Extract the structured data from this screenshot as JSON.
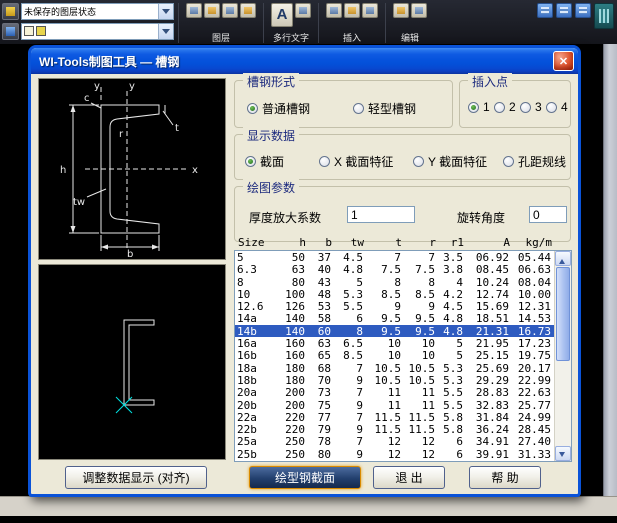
{
  "app_toolbar": {
    "layer_state_combo": "未保存的图层状态",
    "panel_layer": "图层",
    "mtext_icon_glyph": "A",
    "mtext_label": "多行文字",
    "panel_insert": "插入",
    "panel_edit": "编辑"
  },
  "diagram": {
    "axis_y_left": "y",
    "axis_y_right": "y",
    "axis_x": "x",
    "dim_h": "h",
    "dim_b": "b",
    "dim_tw": "tw",
    "dim_t": "t",
    "dim_c": "c",
    "dim_r": "r"
  },
  "dialog": {
    "title": "WI-Tools制图工具 — 槽钢",
    "close_glyph": "✕",
    "form_group": {
      "title": "槽钢形式",
      "options": [
        {
          "label": "普通槽钢",
          "selected": true
        },
        {
          "label": "轻型槽钢",
          "selected": false
        }
      ]
    },
    "insert_group": {
      "title": "插入点",
      "options": [
        {
          "label": "1",
          "selected": true
        },
        {
          "label": "2",
          "selected": false
        },
        {
          "label": "3",
          "selected": false
        },
        {
          "label": "4",
          "selected": false
        }
      ]
    },
    "display_group": {
      "title": "显示数据",
      "options": [
        {
          "label": "截面",
          "selected": true
        },
        {
          "label": "X 截面特征",
          "selected": false
        },
        {
          "label": "Y 截面特征",
          "selected": false
        },
        {
          "label": "孔距规线",
          "selected": false
        }
      ]
    },
    "params_group": {
      "title": "绘图参数",
      "thickness_label": "厚度放大系数",
      "thickness_value": "1",
      "rotation_label": "旋转角度",
      "rotation_value": "0"
    },
    "table": {
      "headers": [
        "Size",
        "h",
        "b",
        "tw",
        "t",
        "r",
        "r1",
        "A",
        "kg/m"
      ],
      "selected_row": "14b",
      "rows": [
        [
          "5",
          "50",
          "37",
          "4.5",
          "7",
          "7",
          "3.5",
          "06.92",
          "05.44"
        ],
        [
          "6.3",
          "63",
          "40",
          "4.8",
          "7.5",
          "7.5",
          "3.8",
          "08.45",
          "06.63"
        ],
        [
          "8",
          "80",
          "43",
          "5",
          "8",
          "8",
          "4",
          "10.24",
          "08.04"
        ],
        [
          "10",
          "100",
          "48",
          "5.3",
          "8.5",
          "8.5",
          "4.2",
          "12.74",
          "10.00"
        ],
        [
          "12.6",
          "126",
          "53",
          "5.5",
          "9",
          "9",
          "4.5",
          "15.69",
          "12.31"
        ],
        [
          "14a",
          "140",
          "58",
          "6",
          "9.5",
          "9.5",
          "4.8",
          "18.51",
          "14.53"
        ],
        [
          "14b",
          "140",
          "60",
          "8",
          "9.5",
          "9.5",
          "4.8",
          "21.31",
          "16.73"
        ],
        [
          "16a",
          "160",
          "63",
          "6.5",
          "10",
          "10",
          "5",
          "21.95",
          "17.23"
        ],
        [
          "16b",
          "160",
          "65",
          "8.5",
          "10",
          "10",
          "5",
          "25.15",
          "19.75"
        ],
        [
          "18a",
          "180",
          "68",
          "7",
          "10.5",
          "10.5",
          "5.3",
          "25.69",
          "20.17"
        ],
        [
          "18b",
          "180",
          "70",
          "9",
          "10.5",
          "10.5",
          "5.3",
          "29.29",
          "22.99"
        ],
        [
          "20a",
          "200",
          "73",
          "7",
          "11",
          "11",
          "5.5",
          "28.83",
          "22.63"
        ],
        [
          "20b",
          "200",
          "75",
          "9",
          "11",
          "11",
          "5.5",
          "32.83",
          "25.77"
        ],
        [
          "22a",
          "220",
          "77",
          "7",
          "11.5",
          "11.5",
          "5.8",
          "31.84",
          "24.99"
        ],
        [
          "22b",
          "220",
          "79",
          "9",
          "11.5",
          "11.5",
          "5.8",
          "36.24",
          "28.45"
        ],
        [
          "25a",
          "250",
          "78",
          "7",
          "12",
          "12",
          "6",
          "34.91",
          "27.40"
        ],
        [
          "25b",
          "250",
          "80",
          "9",
          "12",
          "12",
          "6",
          "39.91",
          "31.33"
        ]
      ]
    },
    "buttons": {
      "adjust": "调整数据显示 (对齐)",
      "draw": "绘型钢截面",
      "exit": "退 出",
      "help": "帮 助"
    }
  }
}
